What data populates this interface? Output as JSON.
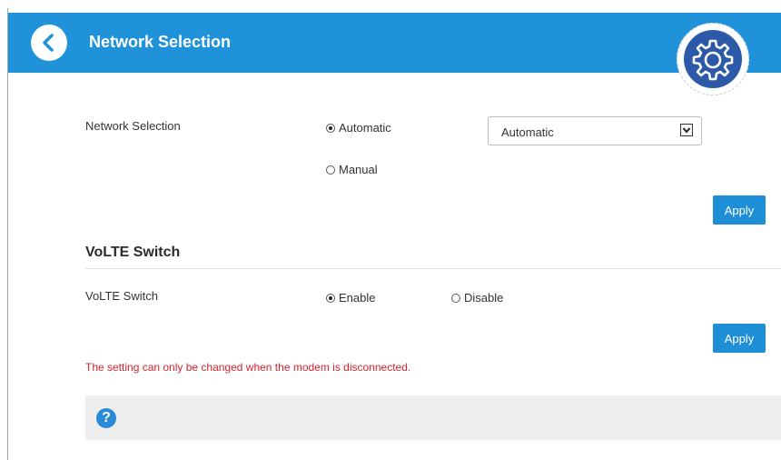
{
  "header": {
    "title": "Network Selection",
    "back_icon": "chevron-left-icon",
    "settings_icon": "gear-icon",
    "color": "#1f92da"
  },
  "network": {
    "label": "Network Selection",
    "options": [
      "Automatic",
      "Manual"
    ],
    "selected": "Automatic",
    "dropdown_value": "Automatic",
    "apply_label": "Apply"
  },
  "volte": {
    "section_title": "VoLTE Switch",
    "label": "VoLTE Switch",
    "options": [
      "Enable",
      "Disable"
    ],
    "selected": "Enable",
    "apply_label": "Apply"
  },
  "warning": "The setting can only be changed when the modem is disconnected.",
  "help": {
    "icon": "help-icon",
    "glyph": "?"
  },
  "colors": {
    "accent": "#1e8fd6",
    "warning": "#d4232f",
    "gear_badge": "#2c5aa8"
  }
}
